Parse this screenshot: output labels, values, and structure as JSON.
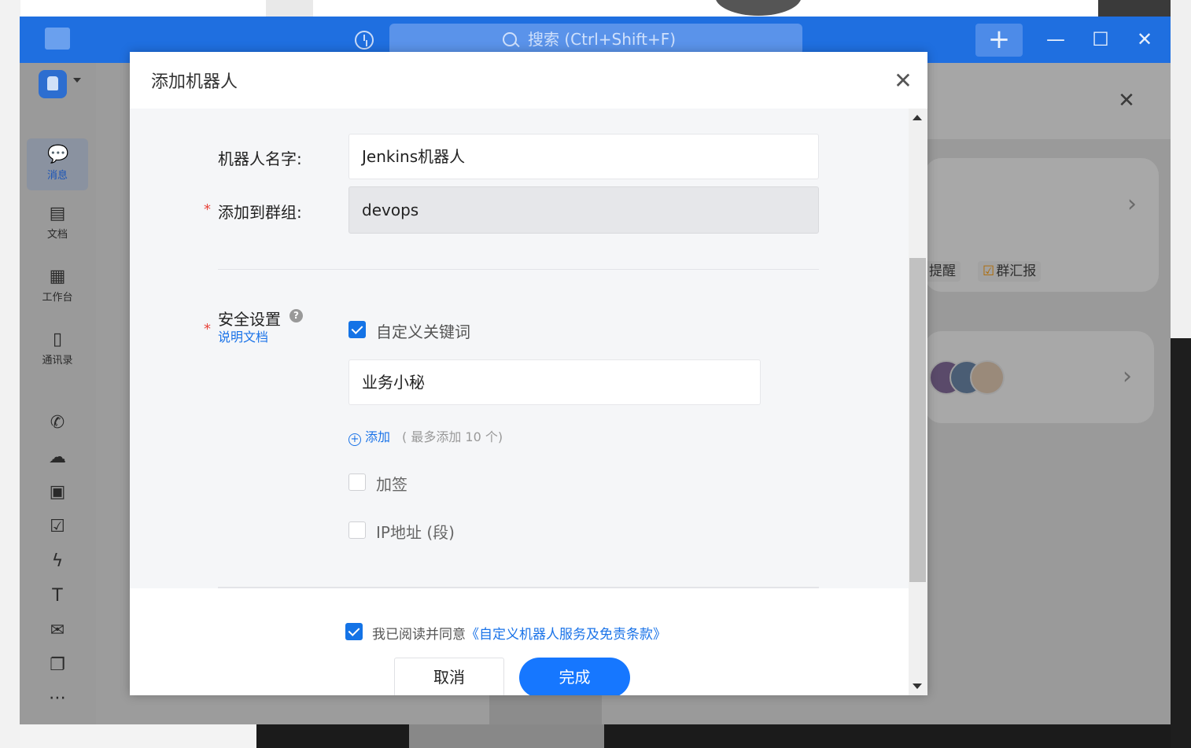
{
  "titlebar": {
    "search_placeholder": "搜索 (Ctrl+Shift+F)",
    "add_label": "+",
    "min_label": "—",
    "max_label": "☐",
    "close_label": "✕",
    "accent_color": "#1f6fe0"
  },
  "sidebar": {
    "items": [
      {
        "label": "消息",
        "icon": "chat-icon"
      },
      {
        "label": "文档",
        "icon": "document-icon"
      },
      {
        "label": "工作台",
        "icon": "grid-icon"
      },
      {
        "label": "通讯录",
        "icon": "contacts-icon"
      }
    ],
    "tools": [
      "phone-icon",
      "cloud-icon",
      "calendar-icon",
      "checkbox-icon",
      "lightning-icon",
      "text-icon",
      "mail-icon",
      "copy-icon",
      "more-icon"
    ]
  },
  "right_panel": {
    "chips": [
      "提醒",
      "群汇报"
    ]
  },
  "modal": {
    "title": "添加机器人",
    "name_label": "机器人名字:",
    "name_value": "Jenkins机器人",
    "group_label": "添加到群组:",
    "group_value": "devops",
    "security_label": "安全设置",
    "doc_link": "说明文档",
    "keyword_option": "自定义关键词",
    "keyword_value": "业务小秘",
    "add_link": "添加",
    "add_hint": "( 最多添加 10 个)",
    "sign_option": "加签",
    "ip_option": "IP地址 (段)",
    "agree_prefix": "我已阅读并同意",
    "agree_link": "《自定义机器人服务及免责条款》",
    "cancel_label": "取消",
    "done_label": "完成",
    "keyword_checked": true,
    "sign_checked": false,
    "ip_checked": false,
    "agree_checked": true,
    "primary_color": "#1677ff"
  }
}
